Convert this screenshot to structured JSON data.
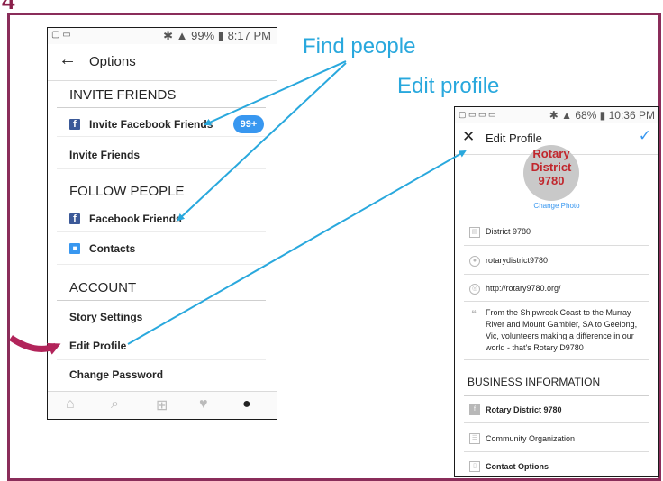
{
  "slide": {
    "corner_number": "4",
    "annotation_find_people": "Find people",
    "annotation_edit_profile": "Edit profile"
  },
  "phone_options": {
    "status_time": "8:17 PM",
    "status_battery": "99%",
    "header_title": "Options",
    "invite_section": "INVITE FRIENDS",
    "invite_facebook": "Invite Facebook Friends",
    "invite_badge": "99+",
    "invite_friends": "Invite Friends",
    "follow_section": "FOLLOW PEOPLE",
    "facebook_friends": "Facebook Friends",
    "contacts": "Contacts",
    "account_section": "ACCOUNT",
    "story_settings": "Story Settings",
    "edit_profile": "Edit Profile",
    "change_password": "Change Password"
  },
  "phone_edit": {
    "status_time": "10:36 PM",
    "status_battery": "68%",
    "header_title": "Edit Profile",
    "avatar_line1": "Rotary",
    "avatar_line2": "District",
    "avatar_line3": "9780",
    "change_photo": "Change Photo",
    "name": "District 9780",
    "username": "rotarydistrict9780",
    "website": "http://rotary9780.org/",
    "bio": "From the Shipwreck Coast to the Murray River and Mount Gambier, SA to Geelong, Vic, volunteers making a difference in our world - that's Rotary D9780",
    "business_section": "BUSINESS INFORMATION",
    "business_page": "Rotary District 9780",
    "category": "Community Organization",
    "contact_options": "Contact Options"
  },
  "colors": {
    "frame": "#8a2d5a",
    "annotation": "#29a8dd",
    "accent_blue": "#3897f0",
    "facebook": "#3b5998"
  }
}
